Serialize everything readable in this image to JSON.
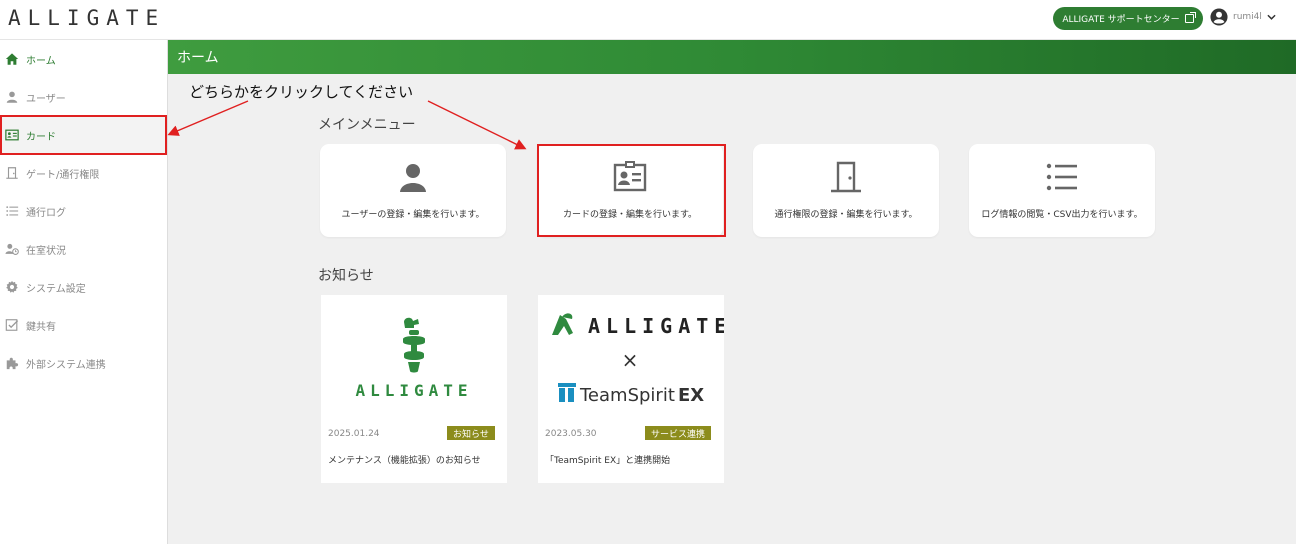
{
  "header": {
    "logo": "ALLIGATE",
    "support_label": "ALLIGATE サポートセンター",
    "username": "rumi4l"
  },
  "colors": {
    "brand_green": "#2e7d32",
    "support_btn": "#2e7d32",
    "badge": "#8c8c1c",
    "annotation_red": "#e02020"
  },
  "sidebar": {
    "items": [
      {
        "label": "ホーム",
        "icon": "home-icon"
      },
      {
        "label": "ユーザー",
        "icon": "user-icon"
      },
      {
        "label": "カード",
        "icon": "id-card-icon"
      },
      {
        "label": "ゲート/通行権限",
        "icon": "door-icon"
      },
      {
        "label": "通行ログ",
        "icon": "list-icon"
      },
      {
        "label": "在室状況",
        "icon": "presence-icon"
      },
      {
        "label": "システム設定",
        "icon": "gear-icon"
      },
      {
        "label": "鍵共有",
        "icon": "checkbox-icon"
      },
      {
        "label": "外部システム連携",
        "icon": "puzzle-icon"
      }
    ]
  },
  "main": {
    "page_title": "ホーム",
    "menu_title": "メインメニュー",
    "menu_cards": [
      {
        "text": "ユーザーの登録・編集を行います。",
        "icon": "user-icon"
      },
      {
        "text": "カードの登録・編集を行います。",
        "icon": "id-card-icon"
      },
      {
        "text": "通行権限の登録・編集を行います。",
        "icon": "door-icon"
      },
      {
        "text": "ログ情報の閲覧・CSV出力を行います。",
        "icon": "list-icon"
      }
    ],
    "news_title": "お知らせ",
    "news": [
      {
        "date": "2025.01.24",
        "badge": "お知らせ",
        "title": "メンテナンス（機能拡張）のお知らせ",
        "logo_text": "ALLIGATE"
      },
      {
        "date": "2023.05.30",
        "badge": "サービス連携",
        "title": "「TeamSpirit EX」と連携開始",
        "logo_text": "ALLIGATE",
        "cross": "×",
        "partner_a": "TeamSpirit",
        "partner_b": "EX"
      }
    ]
  },
  "annotation": {
    "text": "どちらかをクリックしてください"
  }
}
